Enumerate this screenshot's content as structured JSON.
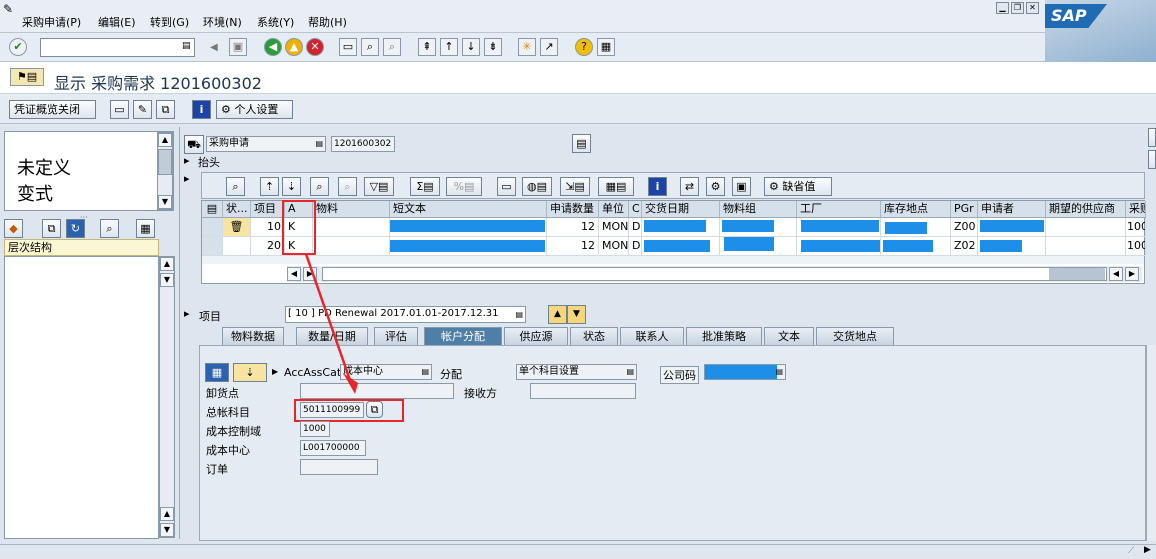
{
  "menu": {
    "items": [
      "采购申请(P)",
      "编辑(E)",
      "转到(G)",
      "环境(N)",
      "系统(Y)",
      "帮助(H)"
    ]
  },
  "brand": "SAP",
  "toolbar": {
    "command_value": ""
  },
  "title": "显示 采购需求 1201600302",
  "app_toolbar": {
    "close_overview": "凭证概览关闭",
    "personal_settings": "个人设置"
  },
  "left_pane": {
    "line1": "未定义",
    "line2": "变式",
    "tree_header": "层次结构"
  },
  "header": {
    "doc_type_value": "采购申请",
    "doc_number": "1201600302",
    "header_label": "抬头"
  },
  "grid": {
    "default_button": "缺省值",
    "columns": [
      "状...",
      "项目",
      "A",
      "物料",
      "短文本",
      "申请数量",
      "单位",
      "C",
      "交货日期",
      "物料组",
      "工厂",
      "库存地点",
      "PGr",
      "申请者",
      "期望的供应商",
      "采购"
    ],
    "rows": [
      {
        "item": "10",
        "acct": "K",
        "qty": "12",
        "unit": "MON",
        "cat": "D",
        "pgr": "Z00",
        "vendor_cut": "100"
      },
      {
        "item": "20",
        "acct": "K",
        "qty": "12",
        "unit": "MON",
        "cat": "D",
        "pgr": "Z02",
        "vendor_cut": "100"
      }
    ]
  },
  "item_selector": {
    "label": "项目",
    "value": "[ 10 ] PD Renewal 2017.01.01-2017.12.31"
  },
  "tabs": [
    "物料数据",
    "数量/日期",
    "评估",
    "帐户分配",
    "供应源",
    "状态",
    "联系人",
    "批准策略",
    "文本",
    "交货地点"
  ],
  "active_tab": "帐户分配",
  "account": {
    "accasscat_label": "AccAssCat",
    "accasscat_value": "成本中心",
    "distribution_label": "分配",
    "distribution_value": "单个科目设置",
    "company_code_label": "公司码",
    "unloading_point_label": "卸货点",
    "unloading_point_value": "",
    "recipient_label": "接收方",
    "recipient_value": "",
    "gl_account_label": "总帐科目",
    "gl_account_value": "5011100999",
    "controlling_area_label": "成本控制域",
    "controlling_area_value": "1000",
    "cost_center_label": "成本中心",
    "cost_center_value": "L001700000",
    "order_label": "订单",
    "order_value": ""
  },
  "colors": {
    "highlight": "#e8262a",
    "redacted": "#1e8fe9",
    "active_tab": "#4f7ea6"
  }
}
